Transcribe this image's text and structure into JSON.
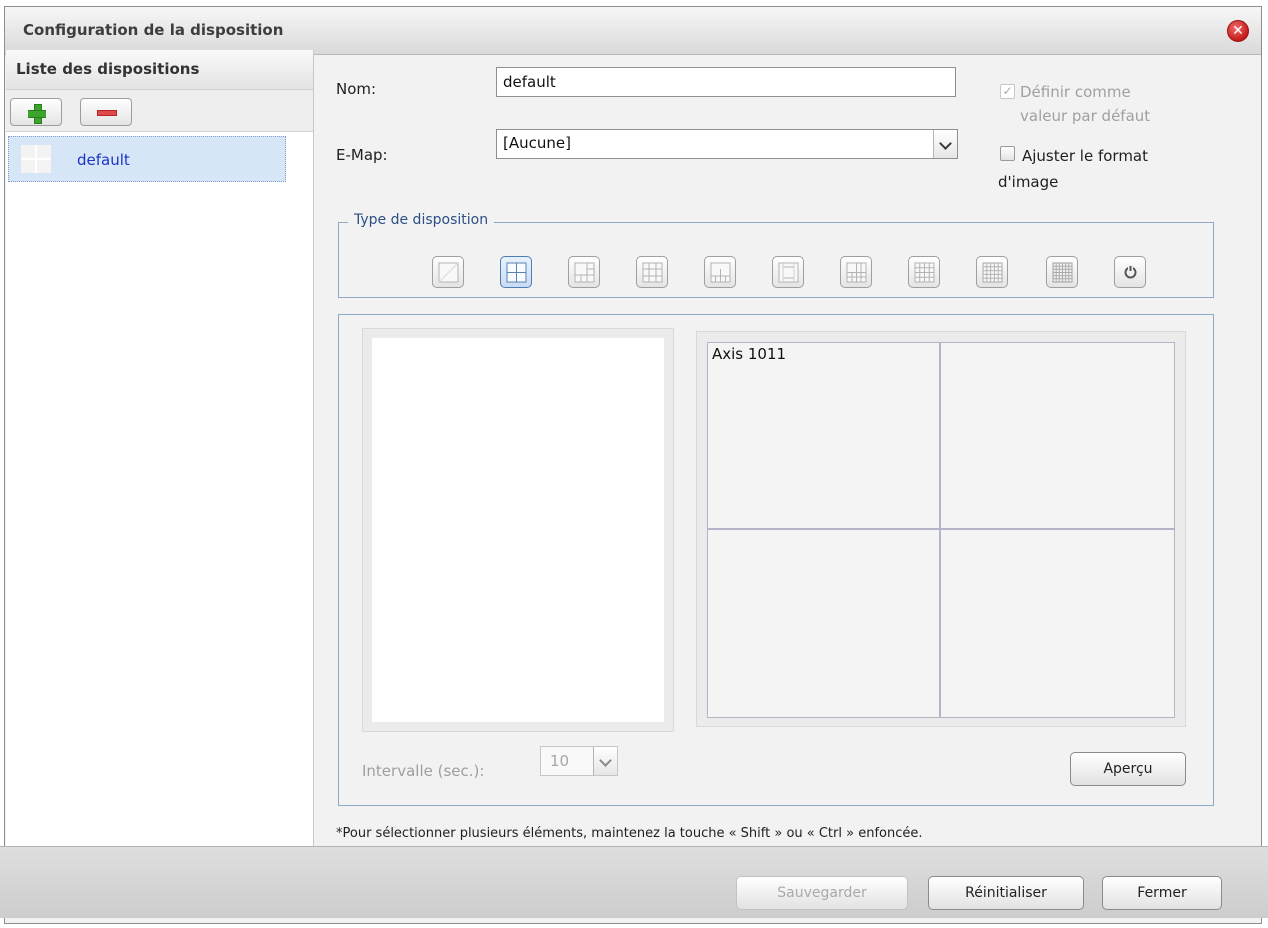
{
  "window": {
    "title": "Configuration de la disposition"
  },
  "left_panel": {
    "title": "Liste des dispositions",
    "layouts": [
      {
        "name": "default",
        "selected": true
      }
    ]
  },
  "form": {
    "name_label": "Nom:",
    "name_value": "default",
    "emap_label": "E-Map:",
    "emap_value": "[Aucune]",
    "default_checkbox_label": "Définir comme valeur par défaut",
    "default_checked": true,
    "aspect_checkbox_label": "Ajuster le format d'image",
    "aspect_checked": false
  },
  "layout_type": {
    "legend": "Type de disposition",
    "selected_index": 1,
    "options": [
      "1",
      "2x2",
      "1+5",
      "3x3",
      "1+7",
      "1+12",
      "4x4",
      "4x4",
      "5x5",
      "6x6",
      "rotate"
    ]
  },
  "preview": {
    "cells": [
      "Axis 1011",
      "",
      "",
      ""
    ],
    "interval_label": "Intervalle (sec.):",
    "interval_value": "10",
    "preview_button": "Aperçu"
  },
  "hint": "*Pour sélectionner plusieurs éléments, maintenez la touche « Shift » ou « Ctrl » enfoncée.",
  "footer": {
    "save": "Sauvegarder",
    "reset": "Réinitialiser",
    "close": "Fermer"
  },
  "colors": {
    "selection": "#d7e6f7",
    "fieldset_border": "#8ea8c7",
    "link_text": "#1a35c4"
  }
}
